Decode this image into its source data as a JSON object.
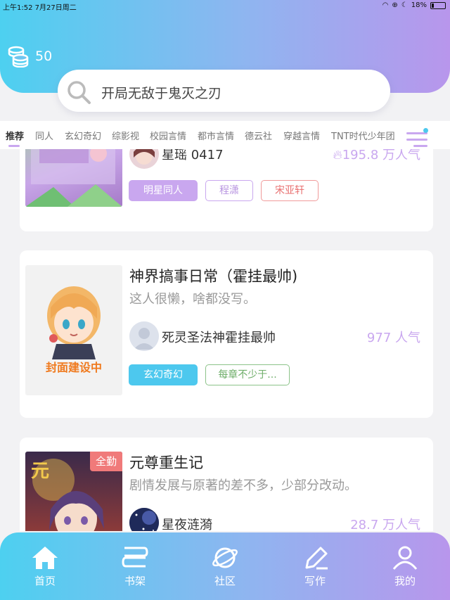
{
  "status_bar": {
    "time_date": "上午1:52  7月27日周二",
    "battery": "18%"
  },
  "header": {
    "coins": "50"
  },
  "search": {
    "text": "开局无敌于鬼灭之刃"
  },
  "tabs": [
    "推荐",
    "同人",
    "玄幻奇幻",
    "综影视",
    "校园言情",
    "都市言情",
    "德云社",
    "穿越言情",
    "TNT时代少年团"
  ],
  "cards": [
    {
      "author": "星瑶 0417",
      "popularity": "195.8 万人气",
      "tags": [
        "明星同人",
        "程潇",
        "宋亚轩"
      ]
    },
    {
      "title": "神界搞事日常（霍挂最帅)",
      "intro": "这人很懒，啥都没写。",
      "author": "死灵圣法神霍挂最帅",
      "popularity": "977 人气",
      "cover_text": "封面建设中",
      "tags": [
        "玄幻奇幻",
        "每章不少于..."
      ]
    },
    {
      "title": "元尊重生记",
      "intro": "剧情发展与原著的差不多，少部分改动。",
      "author": "星夜涟漪",
      "popularity": "28.7 万人气",
      "badge": "全勤"
    }
  ],
  "bottom_nav": [
    "首页",
    "书架",
    "社区",
    "写作",
    "我的"
  ],
  "colors": {
    "accent_purple": "#c9a7ef",
    "accent_cyan": "#4dc8ee",
    "gradient_start": "#4dd0f0",
    "gradient_end": "#b896ec"
  }
}
